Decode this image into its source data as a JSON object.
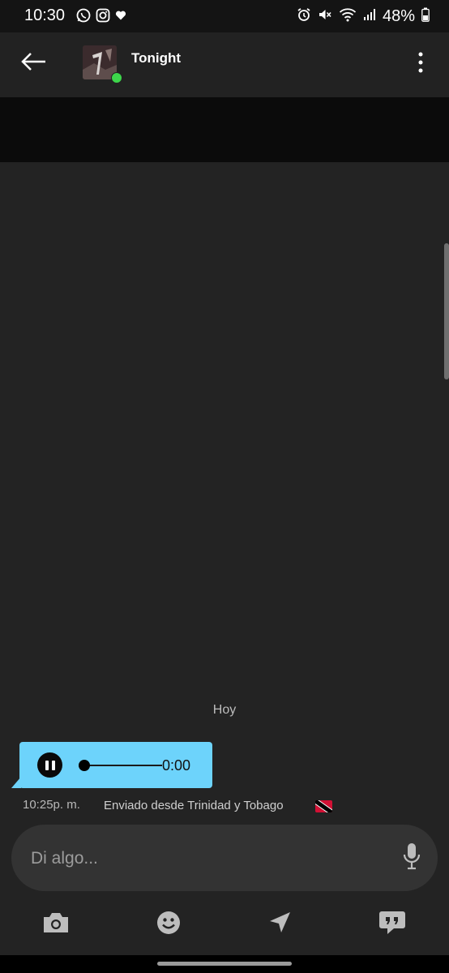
{
  "status_bar": {
    "time": "10:30",
    "battery": "48%",
    "left_icons": [
      "whatsapp-icon",
      "instagram-icon",
      "heart-icon"
    ],
    "right_icons": [
      "alarm-icon",
      "mute-icon",
      "wifi-icon",
      "signal-icon",
      "battery-icon"
    ]
  },
  "header": {
    "contact_name": "Tonight",
    "online": true,
    "status_color": "#3dd64b"
  },
  "conversation": {
    "day_label": "Hoy",
    "voice_message": {
      "duration": "0:00",
      "state": "playing",
      "progress": 0,
      "bubble_color": "#6dd3fb"
    },
    "timestamp": "10:25p. m.",
    "sent_from": "Enviado desde Trinidad y Tobago",
    "flag": "trinidad-and-tobago-flag-icon"
  },
  "composer": {
    "placeholder": "Di algo...",
    "mic": "microphone-icon"
  },
  "toolbar": {
    "items": [
      "camera-icon",
      "emoji-icon",
      "location-arrow-icon",
      "quick-reply-icon"
    ]
  }
}
